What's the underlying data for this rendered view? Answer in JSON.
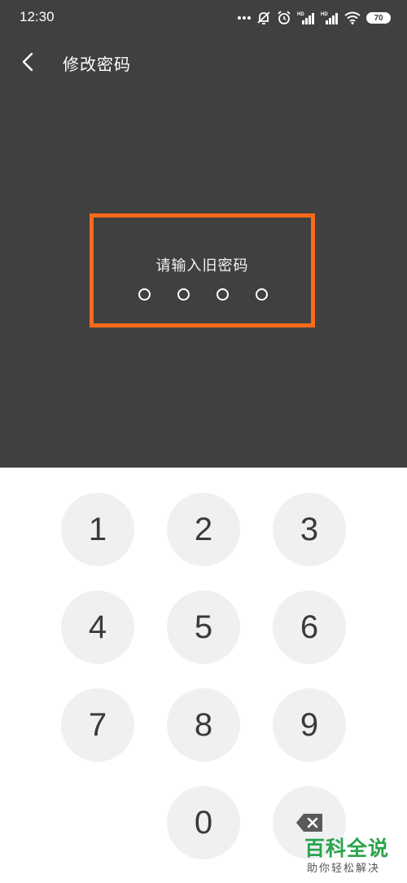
{
  "status_bar": {
    "time": "12:30",
    "battery": "70"
  },
  "header": {
    "title": "修改密码"
  },
  "pin": {
    "prompt": "请输入旧密码",
    "digits_entered": 0,
    "length": 4
  },
  "keypad": {
    "keys": [
      "1",
      "2",
      "3",
      "4",
      "5",
      "6",
      "7",
      "8",
      "9",
      "0"
    ]
  },
  "watermark": {
    "main": "百科全说",
    "sub": "助你轻松解决"
  },
  "colors": {
    "top_background": "#404040",
    "highlight_box": "#ff6a1a",
    "key_background": "#eef0f1",
    "watermark_green": "#2aa44a"
  }
}
